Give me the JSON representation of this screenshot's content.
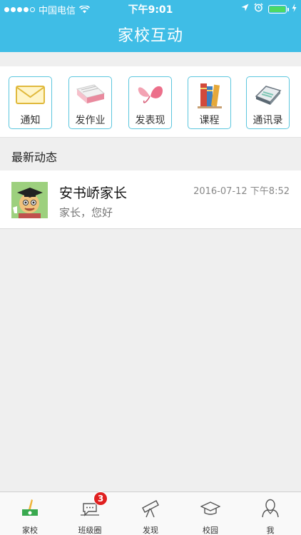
{
  "status_bar": {
    "carrier": "中国电信",
    "time": "下午9:01"
  },
  "nav": {
    "title": "家校互动"
  },
  "shortcuts": [
    {
      "label": "通知",
      "icon": "envelope-icon"
    },
    {
      "label": "发作业",
      "icon": "homework-book-icon"
    },
    {
      "label": "发表现",
      "icon": "butterfly-icon"
    },
    {
      "label": "课程",
      "icon": "books-icon"
    },
    {
      "label": "通讯录",
      "icon": "address-book-icon"
    }
  ],
  "section": {
    "title": "最新动态"
  },
  "feed": [
    {
      "name": "安书峤家长",
      "time": "2016-07-12 下午8:52",
      "message": "家长，您好"
    }
  ],
  "tabs": [
    {
      "label": "家校",
      "icon": "home-school-icon",
      "active": true
    },
    {
      "label": "班级圈",
      "icon": "chat-bubble-icon",
      "badge": "3"
    },
    {
      "label": "发现",
      "icon": "telescope-icon"
    },
    {
      "label": "校园",
      "icon": "graduation-cap-icon"
    },
    {
      "label": "我",
      "icon": "user-icon"
    }
  ],
  "colors": {
    "header": "#3fbde6",
    "shortcut_border": "#5cc6de",
    "badge": "#e02020",
    "background": "#efefef"
  }
}
